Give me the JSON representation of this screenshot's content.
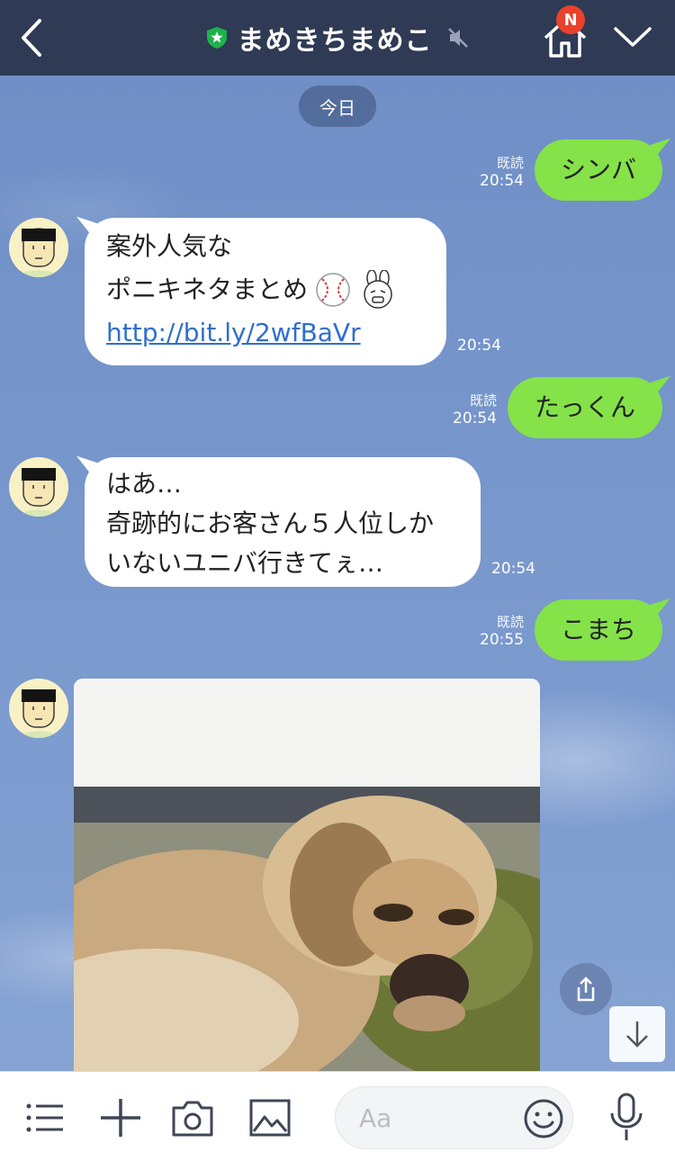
{
  "header": {
    "title": "まめきちまめこ",
    "badge": "N",
    "icons": {
      "back": "chevron-left-icon",
      "verified": "shield-star-icon",
      "mute": "speaker-mute-icon",
      "home": "home-icon",
      "menu": "chevron-down-icon"
    }
  },
  "chat": {
    "date_label": "今日",
    "messages": [
      {
        "side": "mine",
        "text": "シンバ",
        "read": "既読",
        "time": "20:54"
      },
      {
        "side": "theirs",
        "line1": "案外人気な",
        "line2": "ポニキネタまとめ",
        "link": "http://bit.ly/2wfBaVr",
        "time": "20:54"
      },
      {
        "side": "mine",
        "text": "たっくん",
        "read": "既読",
        "time": "20:54"
      },
      {
        "side": "theirs",
        "line1": "はあ…",
        "line2": "奇跡的にお客さん５人位しか",
        "line3": "いないユニバ行きてぇ…",
        "time": "20:54"
      },
      {
        "side": "mine",
        "text": "こまち",
        "read": "既読",
        "time": "20:55"
      },
      {
        "side": "theirs",
        "type": "image",
        "image_subject": "sleeping-dog-photo"
      }
    ]
  },
  "input_bar": {
    "placeholder": "Aa",
    "icons": [
      "menu-icon",
      "plus-icon",
      "camera-icon",
      "image-icon",
      "emoji-icon",
      "mic-icon"
    ]
  },
  "colors": {
    "header_bg": "#2f3a55",
    "mine_bubble": "#85e249",
    "theirs_bubble": "#ffffff",
    "badge": "#e8412c",
    "link": "#2f6fcc"
  }
}
